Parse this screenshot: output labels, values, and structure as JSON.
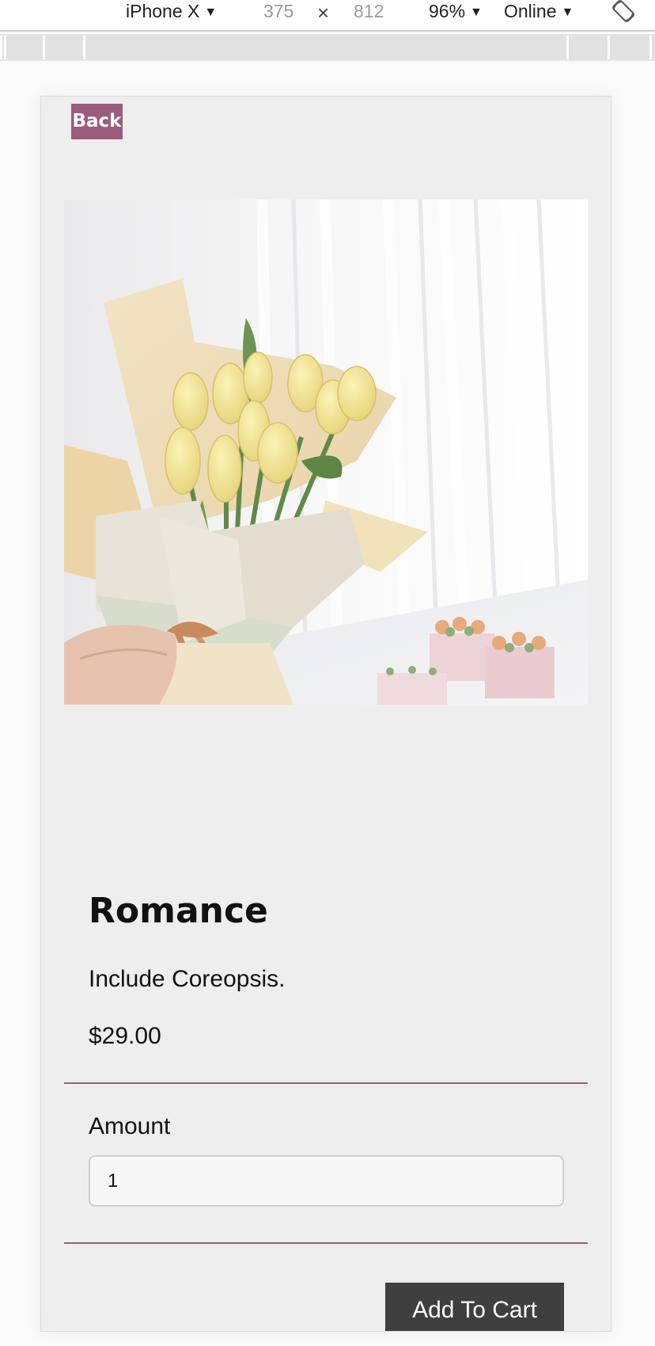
{
  "devtools": {
    "device": "iPhone X",
    "width": "375",
    "separator": "×",
    "height": "812",
    "zoom": "96%",
    "network": "Online"
  },
  "page": {
    "back_label": "Back",
    "image_alt": "Yellow tulip bouquet wrapped in cream paper",
    "title": "Romance",
    "description": "Include Coreopsis.",
    "price": "$29.00",
    "amount_label": "Amount",
    "amount_value": "1",
    "add_to_cart_label": "Add To Cart"
  },
  "colors": {
    "accent": "#9b5b7c",
    "cart_button": "#3f3f3f",
    "frame_background": "#eeeeee"
  },
  "icons": {
    "rotate": "rotate-device-icon",
    "caret": "caret-down-icon"
  }
}
